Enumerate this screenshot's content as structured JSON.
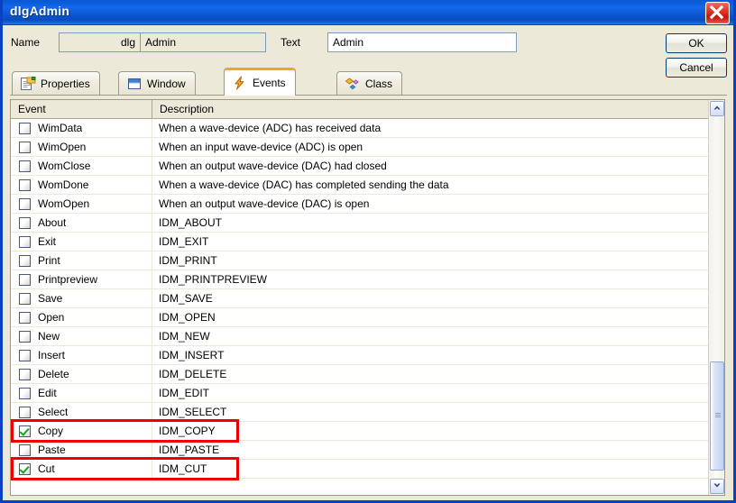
{
  "window": {
    "title": "dlgAdmin",
    "close_icon": "close-x-icon"
  },
  "fields": {
    "name_label": "Name",
    "name_prefix": "dlg",
    "name_value": "Admin",
    "text_label": "Text",
    "text_value": "Admin"
  },
  "buttons": {
    "ok": "OK",
    "cancel": "Cancel"
  },
  "tabs": [
    {
      "label": "Properties",
      "icon": "properties-document-icon",
      "active": false
    },
    {
      "label": "Window",
      "icon": "window-icon",
      "active": false
    },
    {
      "label": "Events",
      "icon": "lightning-bolt-icon",
      "active": true
    },
    {
      "label": "Class",
      "icon": "class-diamonds-icon",
      "active": false
    }
  ],
  "list": {
    "columns": [
      "Event",
      "Description"
    ],
    "rows": [
      {
        "checked": false,
        "event": "WimData",
        "description": "When a wave-device (ADC) has received data"
      },
      {
        "checked": false,
        "event": "WimOpen",
        "description": "When an input wave-device (ADC) is open"
      },
      {
        "checked": false,
        "event": "WomClose",
        "description": "When an output wave-device (DAC) had closed"
      },
      {
        "checked": false,
        "event": "WomDone",
        "description": "When a wave-device (DAC) has completed sending the data"
      },
      {
        "checked": false,
        "event": "WomOpen",
        "description": "When an output wave-device (DAC) is open"
      },
      {
        "checked": false,
        "event": "About",
        "description": "IDM_ABOUT"
      },
      {
        "checked": false,
        "event": "Exit",
        "description": "IDM_EXIT"
      },
      {
        "checked": false,
        "event": "Print",
        "description": "IDM_PRINT"
      },
      {
        "checked": false,
        "event": "Printpreview",
        "description": "IDM_PRINTPREVIEW"
      },
      {
        "checked": false,
        "event": "Save",
        "description": "IDM_SAVE"
      },
      {
        "checked": false,
        "event": "Open",
        "description": "IDM_OPEN"
      },
      {
        "checked": false,
        "event": "New",
        "description": "IDM_NEW"
      },
      {
        "checked": false,
        "event": "Insert",
        "description": "IDM_INSERT"
      },
      {
        "checked": false,
        "event": "Delete",
        "description": "IDM_DELETE"
      },
      {
        "checked": false,
        "event": "Edit",
        "description": "IDM_EDIT"
      },
      {
        "checked": false,
        "event": "Select",
        "description": "IDM_SELECT"
      },
      {
        "checked": true,
        "event": "Copy",
        "description": "IDM_COPY"
      },
      {
        "checked": false,
        "event": "Paste",
        "description": "IDM_PASTE"
      },
      {
        "checked": true,
        "event": "Cut",
        "description": "IDM_CUT"
      }
    ]
  },
  "scrollbar": {
    "up_icon": "chevron-up-icon",
    "down_icon": "chevron-down-icon"
  },
  "annotations": [
    {
      "target": "Copy",
      "color": "#ee0000"
    },
    {
      "target": "Cut",
      "color": "#ee0000"
    }
  ]
}
